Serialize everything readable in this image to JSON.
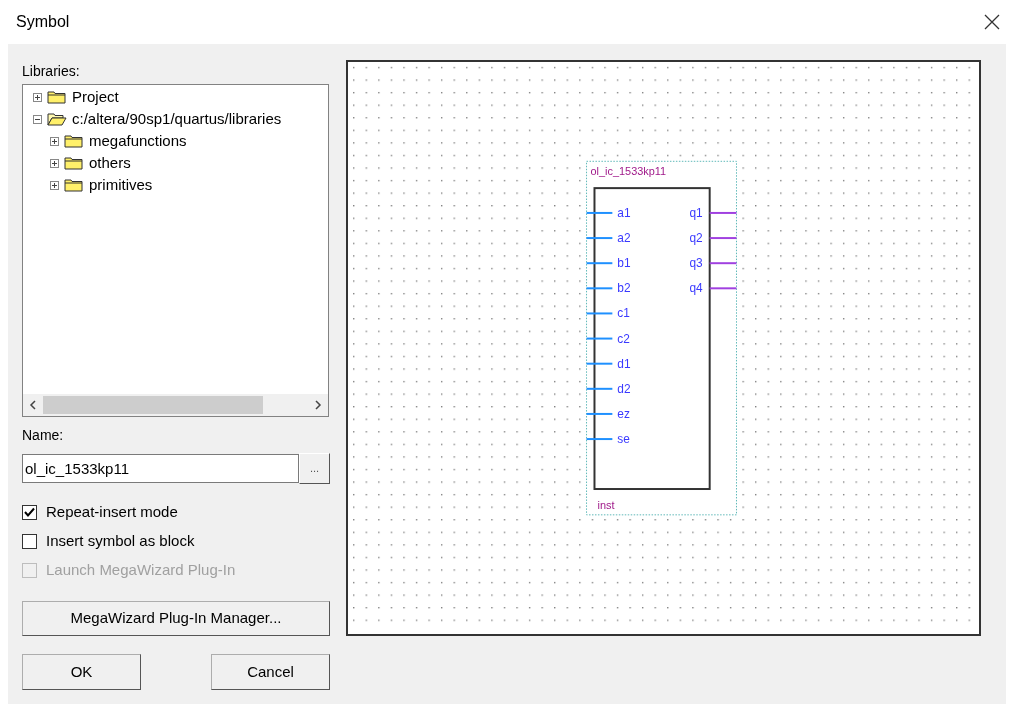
{
  "window": {
    "title": "Symbol"
  },
  "libraries": {
    "label": "Libraries:",
    "tree": [
      {
        "label": "Project",
        "expanded": false
      },
      {
        "label": "c:/altera/90sp1/quartus/libraries",
        "expanded": true,
        "children": [
          {
            "label": "megafunctions",
            "expanded": false
          },
          {
            "label": "others",
            "expanded": false
          },
          {
            "label": "primitives",
            "expanded": false
          }
        ]
      }
    ]
  },
  "name": {
    "label": "Name:",
    "value": "ol_ic_1533kp11",
    "browse_button": "..."
  },
  "options": [
    {
      "label": "Repeat-insert mode",
      "checked": true,
      "disabled": false
    },
    {
      "label": "Insert symbol as block",
      "checked": false,
      "disabled": false
    },
    {
      "label": "Launch MegaWizard Plug-In",
      "checked": false,
      "disabled": true
    }
  ],
  "manager_button": "MegaWizard Plug-In Manager...",
  "buttons": [
    "OK",
    "Cancel"
  ],
  "symbol": {
    "name": "ol_ic_1533kp11",
    "instance": "inst",
    "inputs": [
      "a1",
      "a2",
      "b1",
      "b2",
      "c1",
      "c2",
      "d1",
      "d2",
      "ez",
      "se"
    ],
    "outputs": [
      "q1",
      "q2",
      "q3",
      "q4"
    ]
  }
}
